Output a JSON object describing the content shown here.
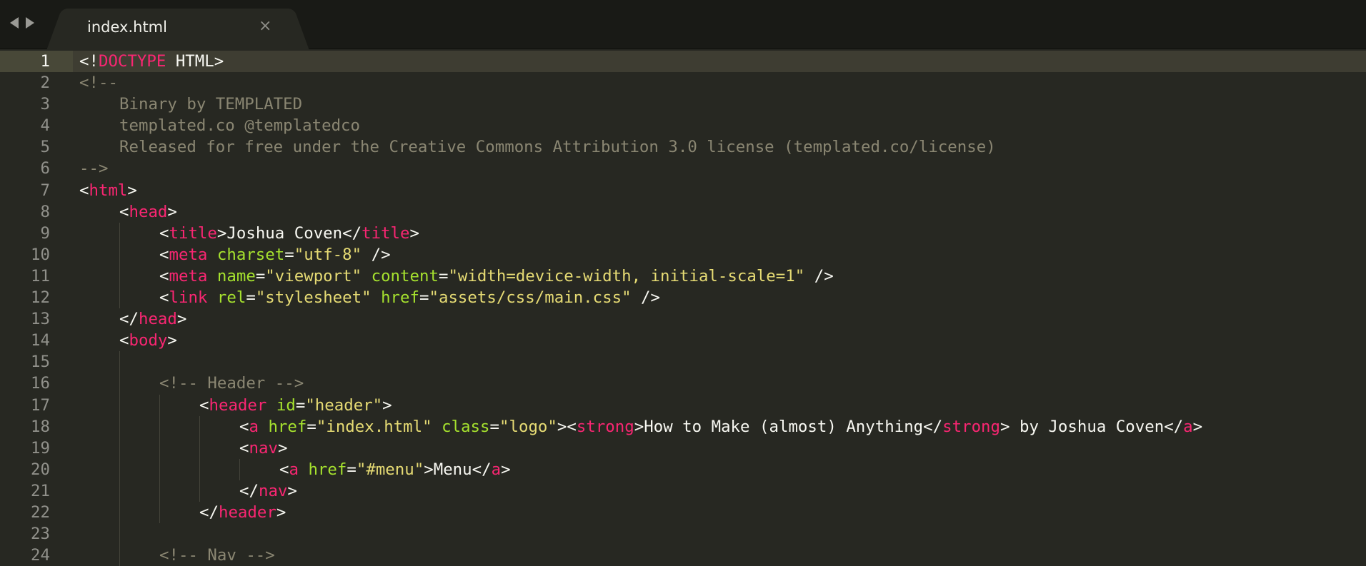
{
  "window": {
    "tab": {
      "title": "index.html",
      "close_glyph": "×"
    },
    "nav": {
      "back_icon": "triangle-left-icon",
      "forward_icon": "triangle-right-icon"
    }
  },
  "editor": {
    "current_line": 1,
    "lines": [
      {
        "n": "1",
        "indent": 0,
        "tokens": [
          [
            "pun",
            "<!"
          ],
          [
            "tag",
            "DOCTYPE"
          ],
          [
            "pun",
            " HTML>"
          ]
        ]
      },
      {
        "n": "2",
        "indent": 0,
        "tokens": [
          [
            "cmt",
            "<!--"
          ]
        ]
      },
      {
        "n": "3",
        "indent": 1,
        "tokens": [
          [
            "cmt",
            "Binary by TEMPLATED"
          ]
        ]
      },
      {
        "n": "4",
        "indent": 1,
        "tokens": [
          [
            "cmt",
            "templated.co @templatedco"
          ]
        ]
      },
      {
        "n": "5",
        "indent": 1,
        "tokens": [
          [
            "cmt",
            "Released for free under the Creative Commons Attribution 3.0 license (templated.co/license)"
          ]
        ]
      },
      {
        "n": "6",
        "indent": 0,
        "tokens": [
          [
            "cmt",
            "-->"
          ]
        ]
      },
      {
        "n": "7",
        "indent": 0,
        "tokens": [
          [
            "pun",
            "<"
          ],
          [
            "tag",
            "html"
          ],
          [
            "pun",
            ">"
          ]
        ]
      },
      {
        "n": "8",
        "indent": 1,
        "tokens": [
          [
            "pun",
            "<"
          ],
          [
            "tag",
            "head"
          ],
          [
            "pun",
            ">"
          ]
        ]
      },
      {
        "n": "9",
        "indent": 2,
        "tokens": [
          [
            "pun",
            "<"
          ],
          [
            "tag",
            "title"
          ],
          [
            "pun",
            ">"
          ],
          [
            "txt",
            "Joshua Coven"
          ],
          [
            "pun",
            "</"
          ],
          [
            "tag",
            "title"
          ],
          [
            "pun",
            ">"
          ]
        ]
      },
      {
        "n": "10",
        "indent": 2,
        "tokens": [
          [
            "pun",
            "<"
          ],
          [
            "tag",
            "meta"
          ],
          [
            "pun",
            " "
          ],
          [
            "attr",
            "charset"
          ],
          [
            "pun",
            "="
          ],
          [
            "str",
            "\"utf-8\""
          ],
          [
            "pun",
            " />"
          ]
        ]
      },
      {
        "n": "11",
        "indent": 2,
        "tokens": [
          [
            "pun",
            "<"
          ],
          [
            "tag",
            "meta"
          ],
          [
            "pun",
            " "
          ],
          [
            "attr",
            "name"
          ],
          [
            "pun",
            "="
          ],
          [
            "str",
            "\"viewport\""
          ],
          [
            "pun",
            " "
          ],
          [
            "attr",
            "content"
          ],
          [
            "pun",
            "="
          ],
          [
            "str",
            "\"width=device-width, initial-scale=1\""
          ],
          [
            "pun",
            " />"
          ]
        ]
      },
      {
        "n": "12",
        "indent": 2,
        "tokens": [
          [
            "pun",
            "<"
          ],
          [
            "tag",
            "link"
          ],
          [
            "pun",
            " "
          ],
          [
            "attr",
            "rel"
          ],
          [
            "pun",
            "="
          ],
          [
            "str",
            "\"stylesheet\""
          ],
          [
            "pun",
            " "
          ],
          [
            "attr",
            "href"
          ],
          [
            "pun",
            "="
          ],
          [
            "str",
            "\"assets/css/main.css\""
          ],
          [
            "pun",
            " />"
          ]
        ]
      },
      {
        "n": "13",
        "indent": 1,
        "tokens": [
          [
            "pun",
            "</"
          ],
          [
            "tag",
            "head"
          ],
          [
            "pun",
            ">"
          ]
        ]
      },
      {
        "n": "14",
        "indent": 1,
        "tokens": [
          [
            "pun",
            "<"
          ],
          [
            "tag",
            "body"
          ],
          [
            "pun",
            ">"
          ]
        ]
      },
      {
        "n": "15",
        "indent": 0,
        "tokens": []
      },
      {
        "n": "16",
        "indent": 2,
        "tokens": [
          [
            "cmt",
            "<!-- Header -->"
          ]
        ]
      },
      {
        "n": "17",
        "indent": 3,
        "tokens": [
          [
            "pun",
            "<"
          ],
          [
            "tag",
            "header"
          ],
          [
            "pun",
            " "
          ],
          [
            "attr",
            "id"
          ],
          [
            "pun",
            "="
          ],
          [
            "str",
            "\"header\""
          ],
          [
            "pun",
            ">"
          ]
        ]
      },
      {
        "n": "18",
        "indent": 4,
        "tokens": [
          [
            "pun",
            "<"
          ],
          [
            "tag",
            "a"
          ],
          [
            "pun",
            " "
          ],
          [
            "attr",
            "href"
          ],
          [
            "pun",
            "="
          ],
          [
            "str",
            "\"index.html\""
          ],
          [
            "pun",
            " "
          ],
          [
            "attr",
            "class"
          ],
          [
            "pun",
            "="
          ],
          [
            "str",
            "\"logo\""
          ],
          [
            "pun",
            "><"
          ],
          [
            "tag",
            "strong"
          ],
          [
            "pun",
            ">"
          ],
          [
            "txt",
            "How to Make (almost) Anything"
          ],
          [
            "pun",
            "</"
          ],
          [
            "tag",
            "strong"
          ],
          [
            "pun",
            ">"
          ],
          [
            "txt",
            " by Joshua Coven"
          ],
          [
            "pun",
            "</"
          ],
          [
            "tag",
            "a"
          ],
          [
            "pun",
            ">"
          ]
        ]
      },
      {
        "n": "19",
        "indent": 4,
        "tokens": [
          [
            "pun",
            "<"
          ],
          [
            "tag",
            "nav"
          ],
          [
            "pun",
            ">"
          ]
        ]
      },
      {
        "n": "20",
        "indent": 5,
        "tokens": [
          [
            "pun",
            "<"
          ],
          [
            "tag",
            "a"
          ],
          [
            "pun",
            " "
          ],
          [
            "attr",
            "href"
          ],
          [
            "pun",
            "="
          ],
          [
            "str",
            "\"#menu\""
          ],
          [
            "pun",
            ">"
          ],
          [
            "txt",
            "Menu"
          ],
          [
            "pun",
            "</"
          ],
          [
            "tag",
            "a"
          ],
          [
            "pun",
            ">"
          ]
        ]
      },
      {
        "n": "21",
        "indent": 4,
        "tokens": [
          [
            "pun",
            "</"
          ],
          [
            "tag",
            "nav"
          ],
          [
            "pun",
            ">"
          ]
        ]
      },
      {
        "n": "22",
        "indent": 3,
        "tokens": [
          [
            "pun",
            "</"
          ],
          [
            "tag",
            "header"
          ],
          [
            "pun",
            ">"
          ]
        ]
      },
      {
        "n": "23",
        "indent": 0,
        "tokens": []
      },
      {
        "n": "24",
        "indent": 2,
        "tokens": [
          [
            "cmt",
            "<!-- Nav -->"
          ]
        ]
      }
    ]
  },
  "colors": {
    "background": "#272822",
    "tabbar": "#191a16",
    "tag": "#f92672",
    "attribute": "#a6e22e",
    "string": "#e6db74",
    "comment": "#8a8672",
    "text": "#f8f8f2"
  }
}
